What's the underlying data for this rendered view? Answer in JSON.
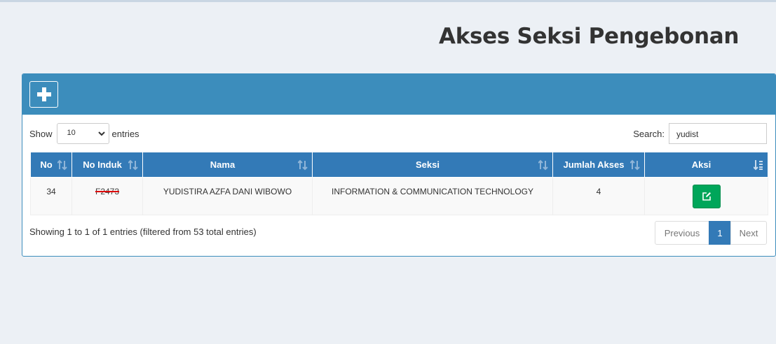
{
  "page": {
    "title": "Akses Seksi Pengebonan"
  },
  "controls": {
    "show_label": "Show",
    "page_size": "10",
    "entries_label": "entries",
    "search_label": "Search:",
    "search_value": "yudist"
  },
  "table": {
    "headers": [
      "No",
      "No Induk",
      "Nama",
      "Seksi",
      "Jumlah Akses",
      "Aksi"
    ],
    "rows": [
      {
        "no": "34",
        "no_induk": "F2473",
        "nama": "YUDISTIRA AZFA DANI WIBOWO",
        "seksi": "INFORMATION & COMMUNICATION TECHNOLOGY",
        "jumlah_akses": "4"
      }
    ]
  },
  "footer": {
    "info": "Showing 1 to 1 of 1 entries (filtered from 53 total entries)",
    "previous": "Previous",
    "current_page": "1",
    "next": "Next"
  },
  "colors": {
    "header": "#3c8dbc",
    "table_header": "#337ab7",
    "edit": "#00a65a",
    "background": "#ecf0f5"
  },
  "icons": {
    "add": "plus-icon",
    "edit": "edit-icon",
    "sort": "sort-icon"
  }
}
